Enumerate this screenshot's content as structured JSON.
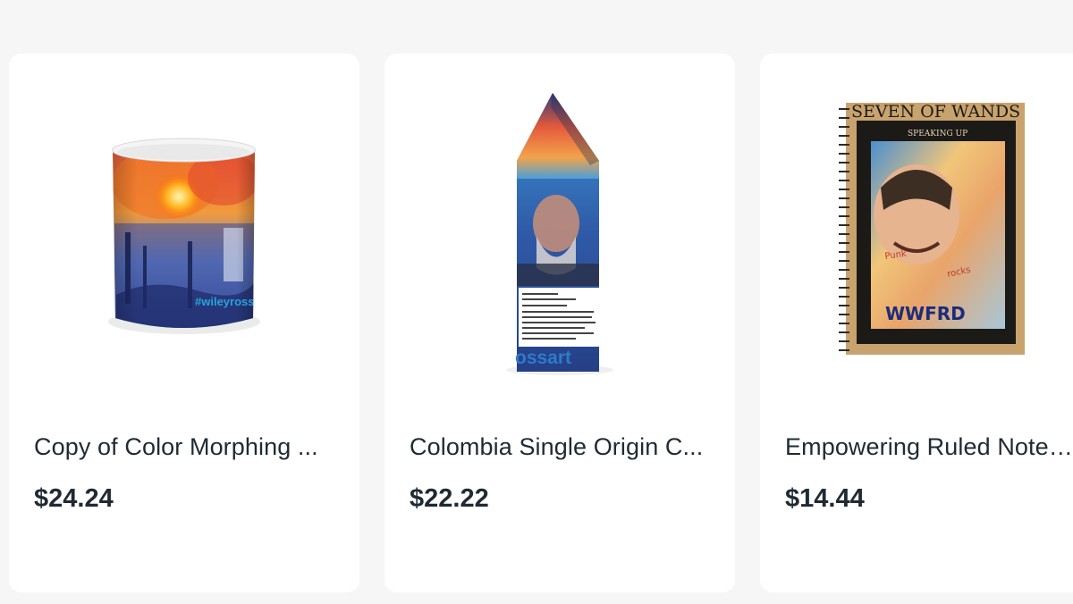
{
  "products": [
    {
      "title": "Copy of Color Morphing ...",
      "price": "$24.24",
      "image_alt": "Color morphing mug with #wileyrossart print",
      "image_text": "#wileyross"
    },
    {
      "title": "Colombia Single Origin C...",
      "price": "$22.22",
      "image_alt": "Colombia single origin coffee bag",
      "image_text": "ossart"
    },
    {
      "title": "Empowering Ruled Noteb...",
      "price": "$14.44",
      "image_alt": "Seven of Wands ruled notebook",
      "image_text": "SEVEN OF WANDS",
      "image_subtext": "SPEAKING UP"
    }
  ],
  "colors": {
    "background": "#f6f6f6",
    "card": "#ffffff",
    "text": "#1f2a33"
  }
}
